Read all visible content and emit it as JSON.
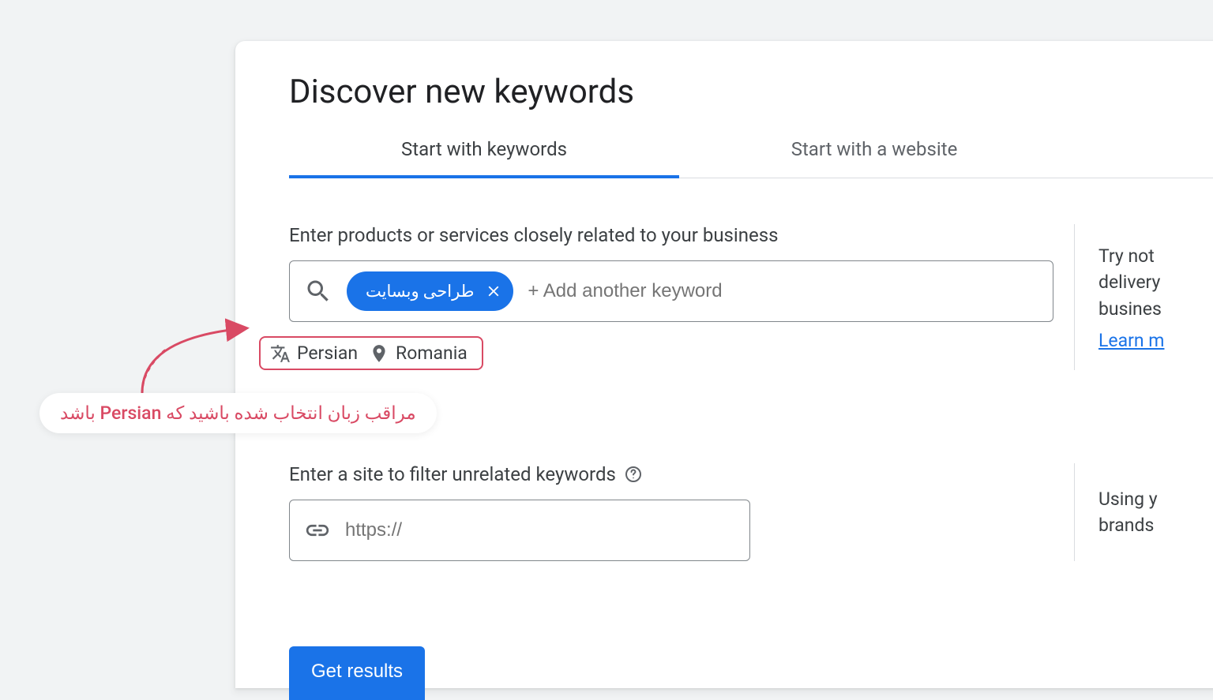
{
  "title": "Discover new keywords",
  "tabs": {
    "keywords": "Start with keywords",
    "website": "Start with a website"
  },
  "keywords_section": {
    "label": "Enter products or services closely related to your business",
    "chip_text": "طراحی وبسایت",
    "add_placeholder": "+ Add another keyword"
  },
  "lang_location": {
    "language": "Persian",
    "location": "Romania"
  },
  "site_section": {
    "label": "Enter a site to filter unrelated keywords",
    "placeholder": "https://"
  },
  "hints": {
    "top": "Try not\ndelivery\nbusines",
    "learn": "Learn m",
    "bottom": "Using y\nbrands"
  },
  "cta": "Get results",
  "annotation": "مراقب زبان انتخاب شده باشید که Persian باشد"
}
